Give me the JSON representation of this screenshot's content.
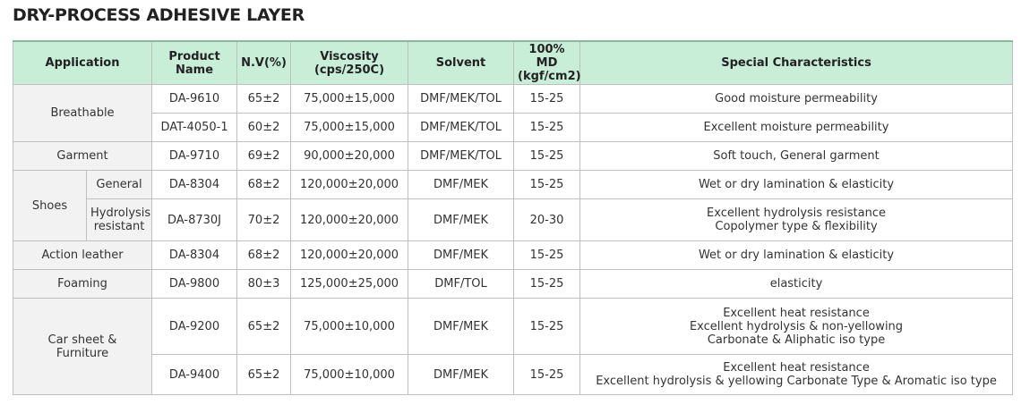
{
  "title": "DRY-PROCESS ADHESIVE LAYER",
  "headers": {
    "application": "Application",
    "product_name": "Product\nName",
    "nv": "N.V(%)",
    "viscosity": "Viscosity\n(cps/250C)",
    "solvent": "Solvent",
    "md": "100% MD\n(kgf/cm2)",
    "special": "Special Characteristics"
  },
  "categories": {
    "breathable": "Breathable",
    "garment": "Garment",
    "shoes": "Shoes",
    "shoes_general": "General",
    "shoes_hydrolysis": "Hydrolysis\nresistant",
    "action_leather": "Action leather",
    "foaming": "Foaming",
    "car_sheet": "Car sheet &\nFurniture"
  },
  "rows": [
    {
      "product": "DA-9610",
      "nv": "65±2",
      "viscosity": "75,000±15,000",
      "solvent": "DMF/MEK/TOL",
      "md": "15-25",
      "special": "Good moisture permeability"
    },
    {
      "product": "DAT-4050-1",
      "nv": "60±2",
      "viscosity": "75,000±15,000",
      "solvent": "DMF/MEK/TOL",
      "md": "15-25",
      "special": "Excellent moisture permeability"
    },
    {
      "product": "DA-9710",
      "nv": "69±2",
      "viscosity": "90,000±20,000",
      "solvent": "DMF/MEK/TOL",
      "md": "15-25",
      "special": "Soft touch, General garment"
    },
    {
      "product": "DA-8304",
      "nv": "68±2",
      "viscosity": "120,000±20,000",
      "solvent": "DMF/MEK",
      "md": "15-25",
      "special": "Wet or dry lamination & elasticity"
    },
    {
      "product": "DA-8730J",
      "nv": "70±2",
      "viscosity": "120,000±20,000",
      "solvent": "DMF/MEK",
      "md": "20-30",
      "special": "Excellent hydrolysis resistance\nCopolymer type & flexibility"
    },
    {
      "product": "DA-8304",
      "nv": "68±2",
      "viscosity": "120,000±20,000",
      "solvent": "DMF/MEK",
      "md": "15-25",
      "special": "Wet or dry lamination & elasticity"
    },
    {
      "product": "DA-9800",
      "nv": "80±3",
      "viscosity": "125,000±25,000",
      "solvent": "DMF/TOL",
      "md": "15-25",
      "special": "elasticity"
    },
    {
      "product": "DA-9200",
      "nv": "65±2",
      "viscosity": "75,000±10,000",
      "solvent": "DMF/MEK",
      "md": "15-25",
      "special": "Excellent heat resistance\nExcellent hydrolysis & non-yellowing\nCarbonate & Aliphatic iso type"
    },
    {
      "product": "DA-9400",
      "nv": "65±2",
      "viscosity": "75,000±10,000",
      "solvent": "DMF/MEK",
      "md": "15-25",
      "special": "Excellent heat resistance\nExcellent hydrolysis & yellowing Carbonate Type & Aromatic iso type"
    }
  ]
}
